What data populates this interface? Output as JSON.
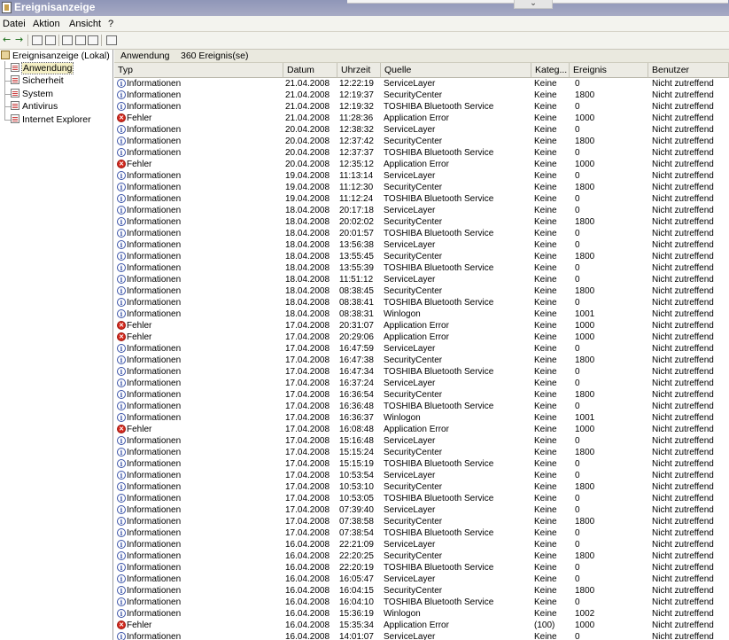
{
  "window": {
    "title": "Ereignisanzeige"
  },
  "menu": {
    "items": [
      "Datei",
      "Aktion",
      "Ansicht",
      "?"
    ]
  },
  "tree": {
    "root": "Ereignisanzeige (Lokal)",
    "logs": [
      "Anwendung",
      "Sicherheit",
      "System",
      "Antivirus",
      "Internet Explorer"
    ],
    "selected": "Anwendung"
  },
  "list": {
    "log_name": "Anwendung",
    "count_label": "360 Ereignis(se)"
  },
  "columns": [
    "Typ",
    "Datum",
    "Uhrzeit",
    "Quelle",
    "Kateg...",
    "Ereignis",
    "Benutzer"
  ],
  "icons": {
    "info": "info-icon",
    "error": "error-icon"
  },
  "colors": {
    "title_bar": "#8f96b8",
    "error": "#d42b1f",
    "info": "#3b53a8"
  },
  "events": [
    {
      "type": "Informationen",
      "kind": "info",
      "date": "21.04.2008",
      "time": "12:22:19",
      "source": "ServiceLayer",
      "category": "Keine",
      "event": "0",
      "user": "Nicht zutreffend"
    },
    {
      "type": "Informationen",
      "kind": "info",
      "date": "21.04.2008",
      "time": "12:19:37",
      "source": "SecurityCenter",
      "category": "Keine",
      "event": "1800",
      "user": "Nicht zutreffend"
    },
    {
      "type": "Informationen",
      "kind": "info",
      "date": "21.04.2008",
      "time": "12:19:32",
      "source": "TOSHIBA Bluetooth Service",
      "category": "Keine",
      "event": "0",
      "user": "Nicht zutreffend"
    },
    {
      "type": "Fehler",
      "kind": "error",
      "date": "21.04.2008",
      "time": "11:28:36",
      "source": "Application Error",
      "category": "Keine",
      "event": "1000",
      "user": "Nicht zutreffend"
    },
    {
      "type": "Informationen",
      "kind": "info",
      "date": "20.04.2008",
      "time": "12:38:32",
      "source": "ServiceLayer",
      "category": "Keine",
      "event": "0",
      "user": "Nicht zutreffend"
    },
    {
      "type": "Informationen",
      "kind": "info",
      "date": "20.04.2008",
      "time": "12:37:42",
      "source": "SecurityCenter",
      "category": "Keine",
      "event": "1800",
      "user": "Nicht zutreffend"
    },
    {
      "type": "Informationen",
      "kind": "info",
      "date": "20.04.2008",
      "time": "12:37:37",
      "source": "TOSHIBA Bluetooth Service",
      "category": "Keine",
      "event": "0",
      "user": "Nicht zutreffend"
    },
    {
      "type": "Fehler",
      "kind": "error",
      "date": "20.04.2008",
      "time": "12:35:12",
      "source": "Application Error",
      "category": "Keine",
      "event": "1000",
      "user": "Nicht zutreffend"
    },
    {
      "type": "Informationen",
      "kind": "info",
      "date": "19.04.2008",
      "time": "11:13:14",
      "source": "ServiceLayer",
      "category": "Keine",
      "event": "0",
      "user": "Nicht zutreffend"
    },
    {
      "type": "Informationen",
      "kind": "info",
      "date": "19.04.2008",
      "time": "11:12:30",
      "source": "SecurityCenter",
      "category": "Keine",
      "event": "1800",
      "user": "Nicht zutreffend"
    },
    {
      "type": "Informationen",
      "kind": "info",
      "date": "19.04.2008",
      "time": "11:12:24",
      "source": "TOSHIBA Bluetooth Service",
      "category": "Keine",
      "event": "0",
      "user": "Nicht zutreffend"
    },
    {
      "type": "Informationen",
      "kind": "info",
      "date": "18.04.2008",
      "time": "20:17:18",
      "source": "ServiceLayer",
      "category": "Keine",
      "event": "0",
      "user": "Nicht zutreffend"
    },
    {
      "type": "Informationen",
      "kind": "info",
      "date": "18.04.2008",
      "time": "20:02:02",
      "source": "SecurityCenter",
      "category": "Keine",
      "event": "1800",
      "user": "Nicht zutreffend"
    },
    {
      "type": "Informationen",
      "kind": "info",
      "date": "18.04.2008",
      "time": "20:01:57",
      "source": "TOSHIBA Bluetooth Service",
      "category": "Keine",
      "event": "0",
      "user": "Nicht zutreffend"
    },
    {
      "type": "Informationen",
      "kind": "info",
      "date": "18.04.2008",
      "time": "13:56:38",
      "source": "ServiceLayer",
      "category": "Keine",
      "event": "0",
      "user": "Nicht zutreffend"
    },
    {
      "type": "Informationen",
      "kind": "info",
      "date": "18.04.2008",
      "time": "13:55:45",
      "source": "SecurityCenter",
      "category": "Keine",
      "event": "1800",
      "user": "Nicht zutreffend"
    },
    {
      "type": "Informationen",
      "kind": "info",
      "date": "18.04.2008",
      "time": "13:55:39",
      "source": "TOSHIBA Bluetooth Service",
      "category": "Keine",
      "event": "0",
      "user": "Nicht zutreffend"
    },
    {
      "type": "Informationen",
      "kind": "info",
      "date": "18.04.2008",
      "time": "11:51:12",
      "source": "ServiceLayer",
      "category": "Keine",
      "event": "0",
      "user": "Nicht zutreffend"
    },
    {
      "type": "Informationen",
      "kind": "info",
      "date": "18.04.2008",
      "time": "08:38:45",
      "source": "SecurityCenter",
      "category": "Keine",
      "event": "1800",
      "user": "Nicht zutreffend"
    },
    {
      "type": "Informationen",
      "kind": "info",
      "date": "18.04.2008",
      "time": "08:38:41",
      "source": "TOSHIBA Bluetooth Service",
      "category": "Keine",
      "event": "0",
      "user": "Nicht zutreffend"
    },
    {
      "type": "Informationen",
      "kind": "info",
      "date": "18.04.2008",
      "time": "08:38:31",
      "source": "Winlogon",
      "category": "Keine",
      "event": "1001",
      "user": "Nicht zutreffend"
    },
    {
      "type": "Fehler",
      "kind": "error",
      "date": "17.04.2008",
      "time": "20:31:07",
      "source": "Application Error",
      "category": "Keine",
      "event": "1000",
      "user": "Nicht zutreffend"
    },
    {
      "type": "Fehler",
      "kind": "error",
      "date": "17.04.2008",
      "time": "20:29:06",
      "source": "Application Error",
      "category": "Keine",
      "event": "1000",
      "user": "Nicht zutreffend"
    },
    {
      "type": "Informationen",
      "kind": "info",
      "date": "17.04.2008",
      "time": "16:47:59",
      "source": "ServiceLayer",
      "category": "Keine",
      "event": "0",
      "user": "Nicht zutreffend"
    },
    {
      "type": "Informationen",
      "kind": "info",
      "date": "17.04.2008",
      "time": "16:47:38",
      "source": "SecurityCenter",
      "category": "Keine",
      "event": "1800",
      "user": "Nicht zutreffend"
    },
    {
      "type": "Informationen",
      "kind": "info",
      "date": "17.04.2008",
      "time": "16:47:34",
      "source": "TOSHIBA Bluetooth Service",
      "category": "Keine",
      "event": "0",
      "user": "Nicht zutreffend"
    },
    {
      "type": "Informationen",
      "kind": "info",
      "date": "17.04.2008",
      "time": "16:37:24",
      "source": "ServiceLayer",
      "category": "Keine",
      "event": "0",
      "user": "Nicht zutreffend"
    },
    {
      "type": "Informationen",
      "kind": "info",
      "date": "17.04.2008",
      "time": "16:36:54",
      "source": "SecurityCenter",
      "category": "Keine",
      "event": "1800",
      "user": "Nicht zutreffend"
    },
    {
      "type": "Informationen",
      "kind": "info",
      "date": "17.04.2008",
      "time": "16:36:48",
      "source": "TOSHIBA Bluetooth Service",
      "category": "Keine",
      "event": "0",
      "user": "Nicht zutreffend"
    },
    {
      "type": "Informationen",
      "kind": "info",
      "date": "17.04.2008",
      "time": "16:36:37",
      "source": "Winlogon",
      "category": "Keine",
      "event": "1001",
      "user": "Nicht zutreffend"
    },
    {
      "type": "Fehler",
      "kind": "error",
      "date": "17.04.2008",
      "time": "16:08:48",
      "source": "Application Error",
      "category": "Keine",
      "event": "1000",
      "user": "Nicht zutreffend"
    },
    {
      "type": "Informationen",
      "kind": "info",
      "date": "17.04.2008",
      "time": "15:16:48",
      "source": "ServiceLayer",
      "category": "Keine",
      "event": "0",
      "user": "Nicht zutreffend"
    },
    {
      "type": "Informationen",
      "kind": "info",
      "date": "17.04.2008",
      "time": "15:15:24",
      "source": "SecurityCenter",
      "category": "Keine",
      "event": "1800",
      "user": "Nicht zutreffend"
    },
    {
      "type": "Informationen",
      "kind": "info",
      "date": "17.04.2008",
      "time": "15:15:19",
      "source": "TOSHIBA Bluetooth Service",
      "category": "Keine",
      "event": "0",
      "user": "Nicht zutreffend"
    },
    {
      "type": "Informationen",
      "kind": "info",
      "date": "17.04.2008",
      "time": "10:53:54",
      "source": "ServiceLayer",
      "category": "Keine",
      "event": "0",
      "user": "Nicht zutreffend"
    },
    {
      "type": "Informationen",
      "kind": "info",
      "date": "17.04.2008",
      "time": "10:53:10",
      "source": "SecurityCenter",
      "category": "Keine",
      "event": "1800",
      "user": "Nicht zutreffend"
    },
    {
      "type": "Informationen",
      "kind": "info",
      "date": "17.04.2008",
      "time": "10:53:05",
      "source": "TOSHIBA Bluetooth Service",
      "category": "Keine",
      "event": "0",
      "user": "Nicht zutreffend"
    },
    {
      "type": "Informationen",
      "kind": "info",
      "date": "17.04.2008",
      "time": "07:39:40",
      "source": "ServiceLayer",
      "category": "Keine",
      "event": "0",
      "user": "Nicht zutreffend"
    },
    {
      "type": "Informationen",
      "kind": "info",
      "date": "17.04.2008",
      "time": "07:38:58",
      "source": "SecurityCenter",
      "category": "Keine",
      "event": "1800",
      "user": "Nicht zutreffend"
    },
    {
      "type": "Informationen",
      "kind": "info",
      "date": "17.04.2008",
      "time": "07:38:54",
      "source": "TOSHIBA Bluetooth Service",
      "category": "Keine",
      "event": "0",
      "user": "Nicht zutreffend"
    },
    {
      "type": "Informationen",
      "kind": "info",
      "date": "16.04.2008",
      "time": "22:21:09",
      "source": "ServiceLayer",
      "category": "Keine",
      "event": "0",
      "user": "Nicht zutreffend"
    },
    {
      "type": "Informationen",
      "kind": "info",
      "date": "16.04.2008",
      "time": "22:20:25",
      "source": "SecurityCenter",
      "category": "Keine",
      "event": "1800",
      "user": "Nicht zutreffend"
    },
    {
      "type": "Informationen",
      "kind": "info",
      "date": "16.04.2008",
      "time": "22:20:19",
      "source": "TOSHIBA Bluetooth Service",
      "category": "Keine",
      "event": "0",
      "user": "Nicht zutreffend"
    },
    {
      "type": "Informationen",
      "kind": "info",
      "date": "16.04.2008",
      "time": "16:05:47",
      "source": "ServiceLayer",
      "category": "Keine",
      "event": "0",
      "user": "Nicht zutreffend"
    },
    {
      "type": "Informationen",
      "kind": "info",
      "date": "16.04.2008",
      "time": "16:04:15",
      "source": "SecurityCenter",
      "category": "Keine",
      "event": "1800",
      "user": "Nicht zutreffend"
    },
    {
      "type": "Informationen",
      "kind": "info",
      "date": "16.04.2008",
      "time": "16:04:10",
      "source": "TOSHIBA Bluetooth Service",
      "category": "Keine",
      "event": "0",
      "user": "Nicht zutreffend"
    },
    {
      "type": "Informationen",
      "kind": "info",
      "date": "16.04.2008",
      "time": "15:36:19",
      "source": "Winlogon",
      "category": "Keine",
      "event": "1002",
      "user": "Nicht zutreffend"
    },
    {
      "type": "Fehler",
      "kind": "error",
      "date": "16.04.2008",
      "time": "15:35:34",
      "source": "Application Error",
      "category": "(100)",
      "event": "1000",
      "user": "Nicht zutreffend"
    },
    {
      "type": "Informationen",
      "kind": "info",
      "date": "16.04.2008",
      "time": "14:01:07",
      "source": "ServiceLayer",
      "category": "Keine",
      "event": "0",
      "user": "Nicht zutreffend"
    }
  ]
}
